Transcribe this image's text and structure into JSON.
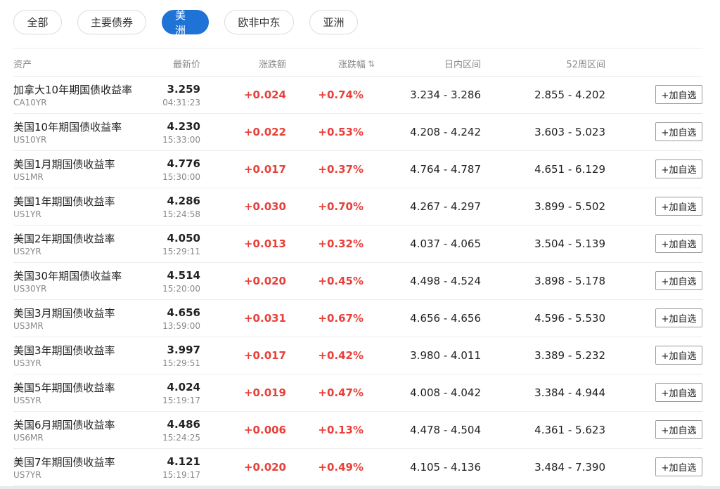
{
  "tabs": [
    {
      "label": "全部",
      "active": false
    },
    {
      "label": "主要债券",
      "active": false
    },
    {
      "label": "美洲",
      "active": true
    },
    {
      "label": "欧非中东",
      "active": false
    },
    {
      "label": "亚洲",
      "active": false
    }
  ],
  "columns": {
    "asset": "资产",
    "price": "最新价",
    "change": "涨跌额",
    "pct": "涨跌幅",
    "sort_icon": "⇅",
    "day_range": "日内区间",
    "range_52": "52周区间"
  },
  "add_label": "+加自选",
  "rows": [
    {
      "name": "加拿大10年期国债收益率",
      "code": "CA10YR",
      "price": "3.259",
      "time": "04:31:23",
      "change": "+0.024",
      "pct": "+0.74%",
      "day": "3.234 - 3.286",
      "r52": "2.855 - 4.202"
    },
    {
      "name": "美国10年期国债收益率",
      "code": "US10YR",
      "price": "4.230",
      "time": "15:33:00",
      "change": "+0.022",
      "pct": "+0.53%",
      "day": "4.208 - 4.242",
      "r52": "3.603 - 5.023"
    },
    {
      "name": "美国1月期国债收益率",
      "code": "US1MR",
      "price": "4.776",
      "time": "15:30:00",
      "change": "+0.017",
      "pct": "+0.37%",
      "day": "4.764 - 4.787",
      "r52": "4.651 - 6.129"
    },
    {
      "name": "美国1年期国债收益率",
      "code": "US1YR",
      "price": "4.286",
      "time": "15:24:58",
      "change": "+0.030",
      "pct": "+0.70%",
      "day": "4.267 - 4.297",
      "r52": "3.899 - 5.502"
    },
    {
      "name": "美国2年期国债收益率",
      "code": "US2YR",
      "price": "4.050",
      "time": "15:29:11",
      "change": "+0.013",
      "pct": "+0.32%",
      "day": "4.037 - 4.065",
      "r52": "3.504 - 5.139"
    },
    {
      "name": "美国30年期国债收益率",
      "code": "US30YR",
      "price": "4.514",
      "time": "15:20:00",
      "change": "+0.020",
      "pct": "+0.45%",
      "day": "4.498 - 4.524",
      "r52": "3.898 - 5.178"
    },
    {
      "name": "美国3月期国债收益率",
      "code": "US3MR",
      "price": "4.656",
      "time": "13:59:00",
      "change": "+0.031",
      "pct": "+0.67%",
      "day": "4.656 - 4.656",
      "r52": "4.596 - 5.530"
    },
    {
      "name": "美国3年期国债收益率",
      "code": "US3YR",
      "price": "3.997",
      "time": "15:29:51",
      "change": "+0.017",
      "pct": "+0.42%",
      "day": "3.980 - 4.011",
      "r52": "3.389 - 5.232"
    },
    {
      "name": "美国5年期国债收益率",
      "code": "US5YR",
      "price": "4.024",
      "time": "15:19:17",
      "change": "+0.019",
      "pct": "+0.47%",
      "day": "4.008 - 4.042",
      "r52": "3.384 - 4.944"
    },
    {
      "name": "美国6月期国债收益率",
      "code": "US6MR",
      "price": "4.486",
      "time": "15:24:25",
      "change": "+0.006",
      "pct": "+0.13%",
      "day": "4.478 - 4.504",
      "r52": "4.361 - 5.623"
    },
    {
      "name": "美国7年期国债收益率",
      "code": "US7YR",
      "price": "4.121",
      "time": "15:19:17",
      "change": "+0.020",
      "pct": "+0.49%",
      "day": "4.105 - 4.136",
      "r52": "3.484 - 7.390"
    }
  ],
  "colors": {
    "accent": "#1f72d6",
    "up": "#e8403a"
  }
}
